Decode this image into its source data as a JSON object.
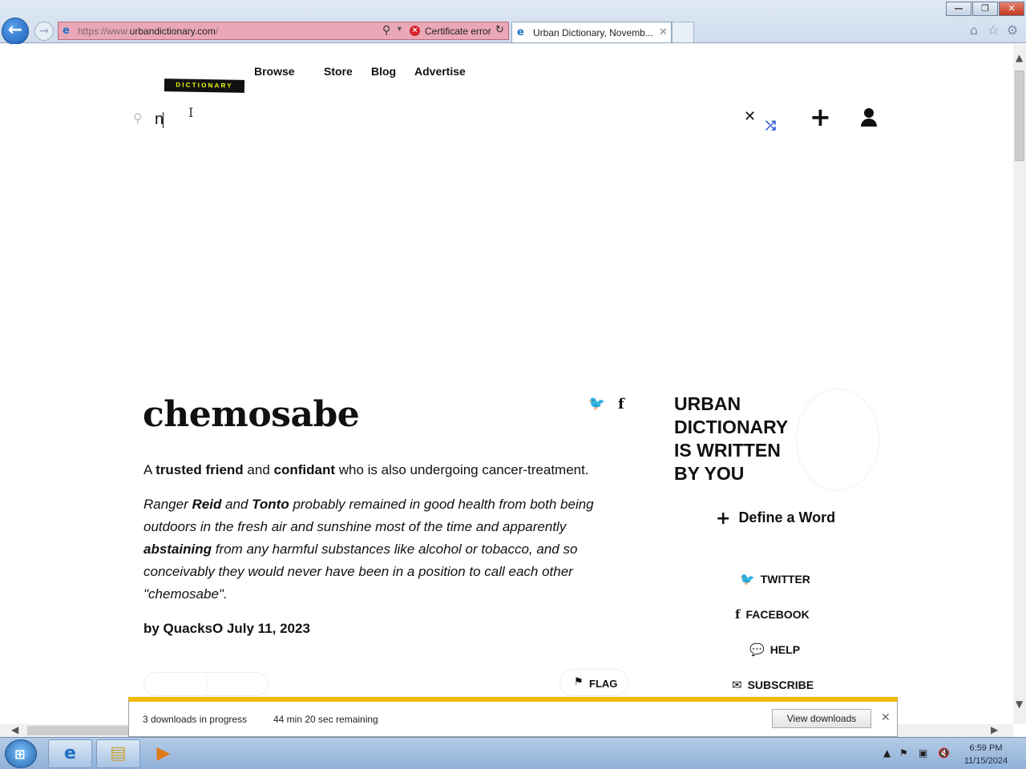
{
  "browser": {
    "url_prefix": "https://www.",
    "url_domain": "urbandictionary.com",
    "url_suffix": "/",
    "cert_error": "Certificate error",
    "tab_title": "Urban Dictionary, Novemb...",
    "icons": {
      "back": "back-arrow-icon",
      "forward": "forward-arrow-icon",
      "home": "home-icon",
      "favorites": "star-icon",
      "tools": "gear-icon"
    }
  },
  "site": {
    "logo_text": "DICTIONARY",
    "nav": [
      "Browse",
      "Store",
      "Blog",
      "Advertise"
    ],
    "search": {
      "value": "n",
      "placeholder": ""
    },
    "accent_color": "#1a4bd6",
    "logo_color": "#efff00"
  },
  "entry": {
    "word": "chemosabe",
    "meaning": [
      {
        "t": "A ",
        "b": false
      },
      {
        "t": "trusted friend",
        "b": true
      },
      {
        "t": " and ",
        "b": false
      },
      {
        "t": "confidant",
        "b": true
      },
      {
        "t": " who is also undergoing cancer-treatment.",
        "b": false
      }
    ],
    "example": [
      {
        "t": "Ranger ",
        "b": false
      },
      {
        "t": "Reid",
        "b": true
      },
      {
        "t": " and ",
        "b": false
      },
      {
        "t": "Tonto",
        "b": true
      },
      {
        "t": " probably remained in good health from both being outdoors in the fresh air and sunshine most of the time and apparently ",
        "b": false
      },
      {
        "t": "abstaining",
        "b": true
      },
      {
        "t": " from any harmful substances like alcohol or tobacco, and so conceivably they would never have been in a position to call each other \"chemosabe\".",
        "b": false
      }
    ],
    "byline": "by QuacksO July 11, 2023",
    "flag_label": "FLAG"
  },
  "sidebar": {
    "promo_lines": [
      "URBAN",
      "DICTIONARY",
      "IS WRITTEN",
      "BY YOU"
    ],
    "define_label": "Define a Word",
    "links": [
      {
        "label": "TWITTER",
        "icon": "twitter-icon"
      },
      {
        "label": "FACEBOOK",
        "icon": "facebook-icon"
      },
      {
        "label": "HELP",
        "icon": "chat-bubble-icon"
      },
      {
        "label": "SUBSCRIBE",
        "icon": "envelope-icon"
      }
    ]
  },
  "downloads": {
    "count_text": "3 downloads in progress",
    "remaining_text": "44 min 20 sec remaining",
    "view_label": "View downloads",
    "progress_color": "#f2b800"
  },
  "taskbar": {
    "time": "6:59 PM",
    "date": "11/15/2024"
  }
}
